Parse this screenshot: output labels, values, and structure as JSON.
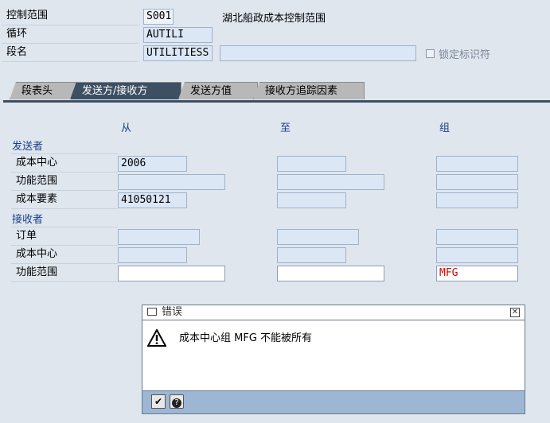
{
  "header": {
    "control_area_label": "控制范围",
    "control_area_value": "S001",
    "control_area_desc": "湖北船政成本控制范围",
    "cycle_label": "循环",
    "cycle_value": "AUTILI",
    "segment_label": "段名",
    "segment_value": "UTILITIESS",
    "segment_desc": "",
    "lock_label": "锁定标识符"
  },
  "tabs": [
    {
      "label": "段表头",
      "active": false
    },
    {
      "label": "发送方/接收方",
      "active": true
    },
    {
      "label": "发送方值",
      "active": false
    },
    {
      "label": "接收方追踪因素",
      "active": false
    }
  ],
  "columns": {
    "from": "从",
    "to": "至",
    "group": "组"
  },
  "sender": {
    "title": "发送者",
    "rows": [
      {
        "label": "成本中心",
        "from": "2006",
        "to": "",
        "group": ""
      },
      {
        "label": "功能范围",
        "from": "",
        "to": "",
        "group": ""
      },
      {
        "label": "成本要素",
        "from": "41050121",
        "to": "",
        "group": ""
      }
    ]
  },
  "receiver": {
    "title": "接收者",
    "rows": [
      {
        "label": "订单",
        "from": "",
        "to": "",
        "group": ""
      },
      {
        "label": "成本中心",
        "from": "",
        "to": "",
        "group": ""
      },
      {
        "label": "功能范围",
        "from": "",
        "to": "",
        "group": "MFG"
      }
    ]
  },
  "dialog": {
    "title": "错误",
    "message": "成本中心组 MFG 不能被所有",
    "icons": [
      "warning-icon",
      "close-icon",
      "check-icon",
      "help-icon"
    ]
  },
  "colors": {
    "tab_active": "#3d4f63",
    "field_bg": "#dce7f5",
    "error_red": "#d40000",
    "label_blue": "#1a3d8a"
  }
}
